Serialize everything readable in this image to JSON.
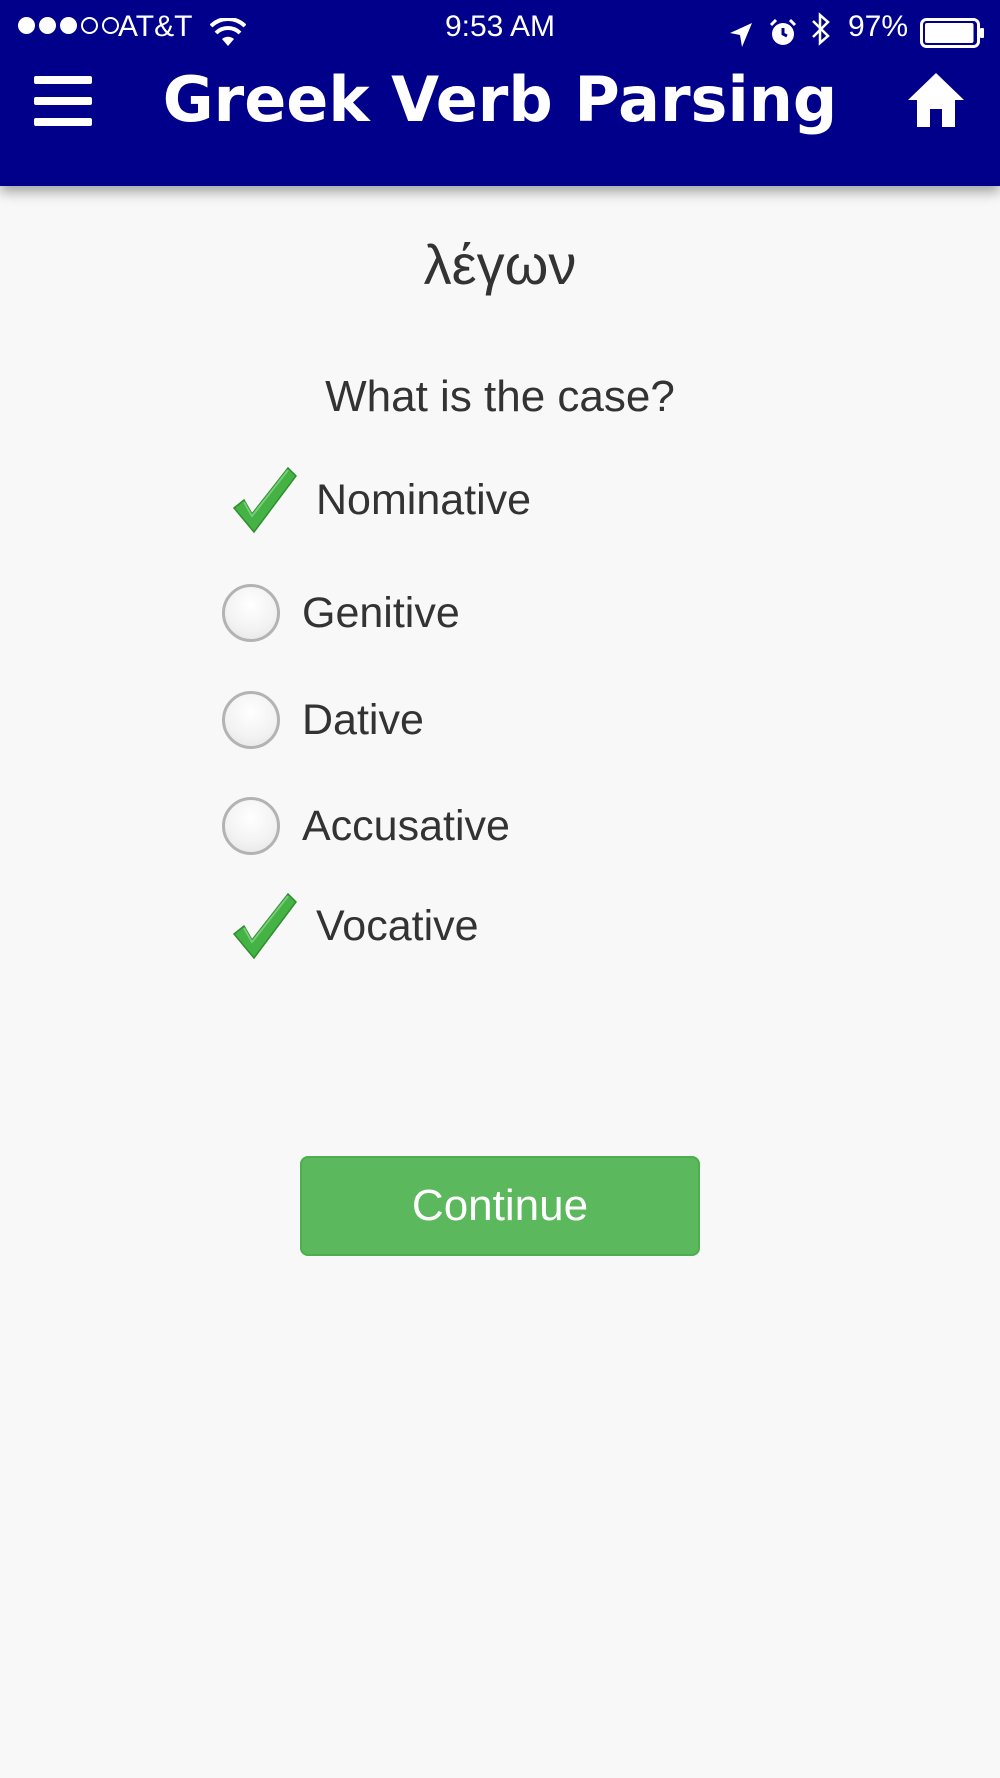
{
  "status_bar": {
    "carrier": "AT&T",
    "time": "9:53 AM",
    "battery_percent": "97%",
    "signal_bars_filled": 3,
    "signal_bars_total": 5,
    "battery_level": 0.97,
    "icons": [
      "wifi-icon",
      "location-arrow-icon",
      "alarm-clock-icon",
      "bluetooth-icon",
      "battery-icon"
    ]
  },
  "header": {
    "title": "Greek Verb Parsing",
    "menu_icon": "hamburger-menu-icon",
    "home_icon": "home-icon",
    "background_color": "#00008b"
  },
  "quiz": {
    "word": "λέγων",
    "question": "What is the case?",
    "options": [
      {
        "label": "Nominative",
        "state": "correct"
      },
      {
        "label": "Genitive",
        "state": "unselected"
      },
      {
        "label": "Dative",
        "state": "unselected"
      },
      {
        "label": "Accusative",
        "state": "unselected"
      },
      {
        "label": "Vocative",
        "state": "correct"
      }
    ],
    "check_color": "#44b244"
  },
  "actions": {
    "continue_label": "Continue",
    "continue_color": "#5cb85c"
  }
}
